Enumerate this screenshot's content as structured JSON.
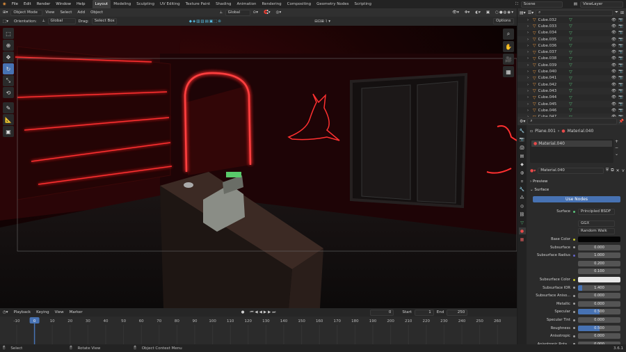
{
  "menu": [
    "File",
    "Edit",
    "Render",
    "Window",
    "Help"
  ],
  "workspaces": [
    {
      "label": "Layout",
      "active": true
    },
    {
      "label": "Modeling",
      "active": false
    },
    {
      "label": "Sculpting",
      "active": false
    },
    {
      "label": "UV Editing",
      "active": false
    },
    {
      "label": "Texture Paint",
      "active": false
    },
    {
      "label": "Shading",
      "active": false
    },
    {
      "label": "Animation",
      "active": false
    },
    {
      "label": "Rendering",
      "active": false
    },
    {
      "label": "Compositing",
      "active": false
    },
    {
      "label": "Geometry Nodes",
      "active": false
    },
    {
      "label": "Scripting",
      "active": false
    }
  ],
  "scene": "Scene",
  "view_layer": "ViewLayer",
  "viewport_header": {
    "mode": "Object Mode",
    "items": [
      "View",
      "Select",
      "Add",
      "Object"
    ],
    "transform": "Global"
  },
  "tool_settings": {
    "orientation_label": "Orientation:",
    "orientation": "Global",
    "drag_label": "Drag:",
    "drag": "Select Box",
    "options": "Options"
  },
  "outliner": {
    "items": [
      "Cube.032",
      "Cube.033",
      "Cube.034",
      "Cube.035",
      "Cube.036",
      "Cube.037",
      "Cube.038",
      "Cube.039",
      "Cube.040",
      "Cube.041",
      "Cube.042",
      "Cube.043",
      "Cube.044",
      "Cube.045",
      "Cube.046",
      "Cube.047"
    ]
  },
  "properties": {
    "object": "Plane.001",
    "material": "Material.040",
    "slot": "Material.040",
    "datablock": "Material.040",
    "preview": "Preview",
    "surface_section": "Surface",
    "use_nodes": "Use Nodes",
    "surface_label": "Surface",
    "surface_value": "Principled BSDF",
    "distribution": "GGX",
    "subsurface_method": "Random Walk",
    "rows": [
      {
        "label": "Base Color",
        "value": "",
        "kind": "color",
        "color": "#050505"
      },
      {
        "label": "Subsurface",
        "value": "0.000",
        "kind": "num",
        "fill": 0
      },
      {
        "label": "Subsurface Radius",
        "value": "1.000",
        "kind": "num",
        "fill": 0
      },
      {
        "label": "",
        "value": "0.200",
        "kind": "num",
        "fill": 0
      },
      {
        "label": "",
        "value": "0.100",
        "kind": "num",
        "fill": 0
      },
      {
        "label": "Subsurface Color",
        "value": "",
        "kind": "color",
        "color": "#e8e8e8"
      },
      {
        "label": "Subsurface IOR",
        "value": "1.400",
        "kind": "num",
        "fill": 0.1
      },
      {
        "label": "Subsurface Aniso...",
        "value": "0.000",
        "kind": "num",
        "fill": 0
      },
      {
        "label": "Metallic",
        "value": "0.000",
        "kind": "num",
        "fill": 0
      },
      {
        "label": "Specular",
        "value": "0.500",
        "kind": "num",
        "fill": 0.5
      },
      {
        "label": "Specular Tint",
        "value": "0.000",
        "kind": "num",
        "fill": 0
      },
      {
        "label": "Roughness",
        "value": "0.500",
        "kind": "num",
        "fill": 0.5
      },
      {
        "label": "Anisotropic",
        "value": "0.000",
        "kind": "num",
        "fill": 0
      },
      {
        "label": "Anisotropic Rota...",
        "value": "0.000",
        "kind": "num",
        "fill": 0
      }
    ]
  },
  "timeline": {
    "items": [
      "Playback",
      "Keying",
      "View",
      "Marker"
    ],
    "current": "0",
    "start_label": "Start",
    "start": "1",
    "end_label": "End",
    "end": "250",
    "ticks": [
      "-10",
      "0",
      "10",
      "20",
      "30",
      "40",
      "50",
      "60",
      "70",
      "80",
      "90",
      "100",
      "110",
      "120",
      "130",
      "140",
      "150",
      "160",
      "170",
      "180",
      "190",
      "200",
      "210",
      "220",
      "230",
      "240",
      "250",
      "260"
    ],
    "playhead": "0"
  },
  "status": {
    "select": "Select",
    "rotate": "Rotate View",
    "context": "Object Context Menu",
    "version": "3.6.1"
  }
}
